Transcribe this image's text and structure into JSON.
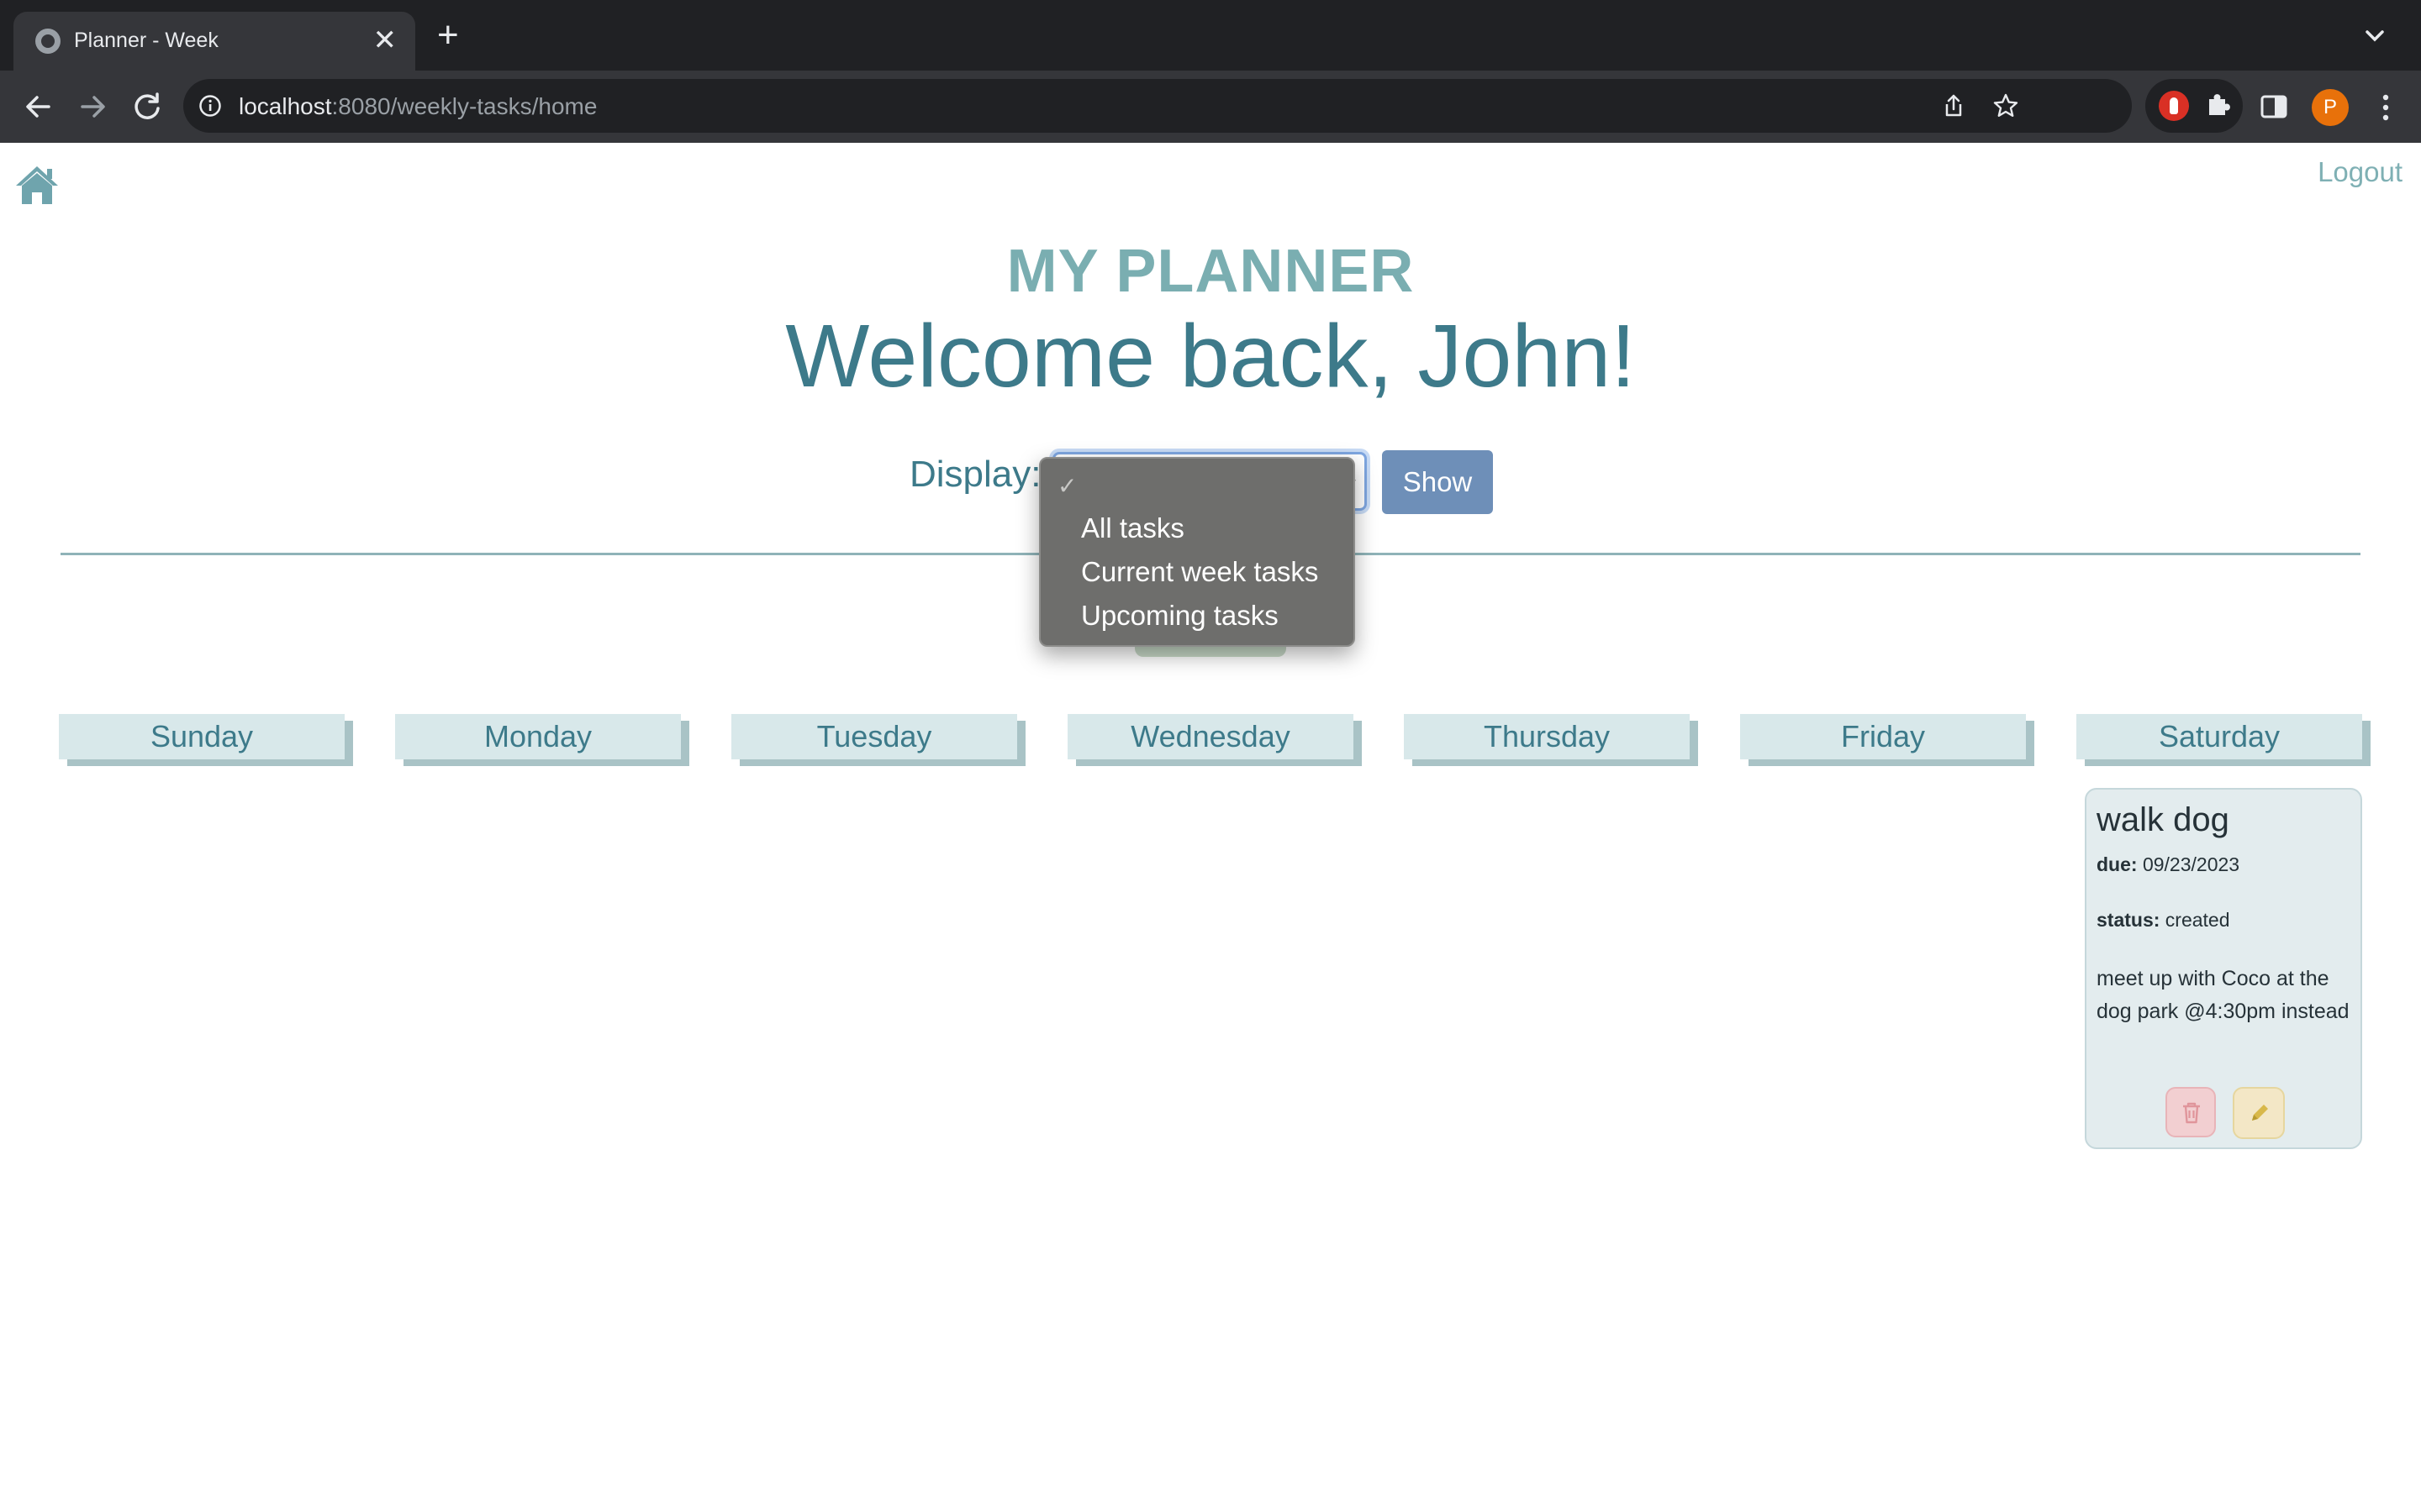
{
  "browser": {
    "tab_title": "Planner - Week",
    "tab_close": "✕",
    "new_tab": "+",
    "url_host": "localhost",
    "url_rest": ":8080/weekly-tasks/home",
    "profile_initial": "P"
  },
  "page": {
    "logout": "Logout",
    "brand": "MY PLANNER",
    "welcome": "Welcome back, John!",
    "display_label": "Display:",
    "select_value": "",
    "show_button": "Show"
  },
  "dropdown": {
    "check": "✓",
    "options": [
      "All tasks",
      "Current week tasks",
      "Upcoming tasks"
    ]
  },
  "days": [
    "Sunday",
    "Monday",
    "Tuesday",
    "Wednesday",
    "Thursday",
    "Friday",
    "Saturday"
  ],
  "task": {
    "title": "walk dog",
    "due_label": "due:",
    "due_value": "09/23/2023",
    "status_label": "status:",
    "status_value": "created",
    "description": "meet up with Coco at the dog park @4:30pm instead"
  },
  "colors": {
    "accent_teal": "#3d7a8a",
    "brand_teal": "#7aaeb1",
    "show_button": "#6e8fb8",
    "day_header": "#d8e8ea",
    "delete_button": "#f2cfd1",
    "edit_button": "#f3e7c6"
  },
  "icons": {
    "home": "home-icon",
    "trash": "trash-icon",
    "pencil": "pencil-icon"
  }
}
